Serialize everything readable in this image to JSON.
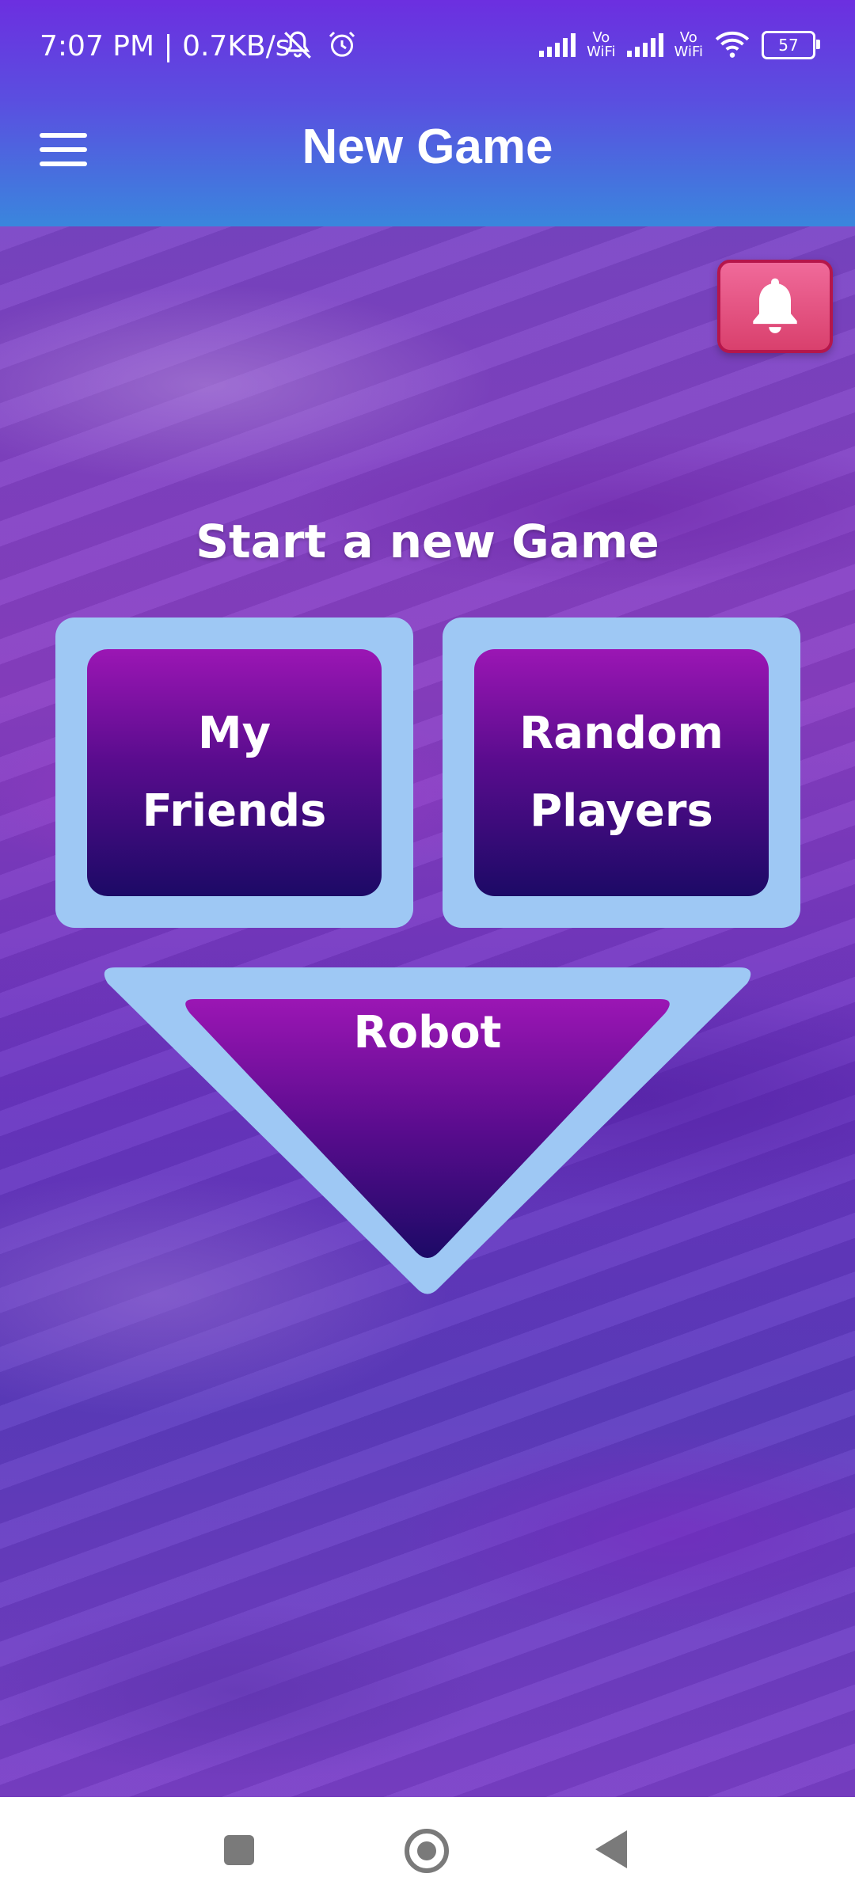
{
  "status_bar": {
    "time_speed": "7:07 PM | 0.7KB/s",
    "vowifi_1": "Vo\nWiFi",
    "vowifi_2": "Vo\nWiFi",
    "battery": "57",
    "icons": [
      "bell-off-icon",
      "alarm-icon",
      "signal-icon",
      "wifi-icon",
      "battery-icon"
    ]
  },
  "app_bar": {
    "title": "New Game",
    "menu_icon": "hamburger-menu-icon"
  },
  "main": {
    "notification_icon": "bell-icon",
    "heading": "Start a new Game",
    "options": {
      "friends": "My\nFriends",
      "random": "Random\nPlayers",
      "robot": "Robot"
    }
  },
  "colors": {
    "app_bar_top": "#6c2fe0",
    "app_bar_bottom": "#3a86dd",
    "card_frame": "#9ec8f4",
    "button_top": "#9b16b4",
    "button_bottom": "#1c0a66",
    "notify_button": "#e8557f"
  },
  "nav_bar": {
    "icons": [
      "recents-square-icon",
      "home-circle-icon",
      "back-triangle-icon"
    ]
  }
}
